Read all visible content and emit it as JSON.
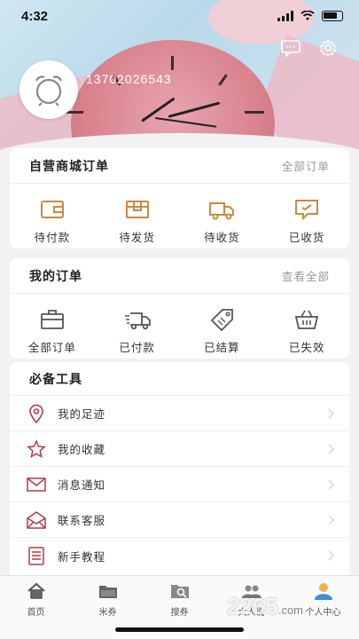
{
  "status_bar": {
    "time": "4:32"
  },
  "profile": {
    "phone": "13702026543"
  },
  "self_orders": {
    "title": "自营商城订单",
    "link": "全部订单",
    "items": [
      {
        "label": "待付款",
        "icon": "wallet-icon"
      },
      {
        "label": "待发货",
        "icon": "package-icon"
      },
      {
        "label": "待收货",
        "icon": "truck-icon"
      },
      {
        "label": "已收货",
        "icon": "message-box-icon"
      }
    ]
  },
  "my_orders": {
    "title": "我的订单",
    "link": "查看全部",
    "items": [
      {
        "label": "全部订单",
        "icon": "briefcase-icon"
      },
      {
        "label": "已付款",
        "icon": "delivery-truck-icon"
      },
      {
        "label": "已结算",
        "icon": "tag-icon"
      },
      {
        "label": "已失效",
        "icon": "basket-icon"
      }
    ]
  },
  "tools": {
    "title": "必备工具",
    "items": [
      {
        "label": "我的足迹",
        "icon": "location-pin-icon"
      },
      {
        "label": "我的收藏",
        "icon": "star-icon"
      },
      {
        "label": "消息通知",
        "icon": "envelope-icon"
      },
      {
        "label": "联系客服",
        "icon": "mail-open-icon"
      },
      {
        "label": "新手教程",
        "icon": "document-list-icon"
      }
    ]
  },
  "tabbar": {
    "items": [
      {
        "label": "首页",
        "icon": "home-icon"
      },
      {
        "label": "米券",
        "icon": "folder-icon"
      },
      {
        "label": "搜券",
        "icon": "search-folder-icon"
      },
      {
        "label": "大人说",
        "icon": "people-icon"
      },
      {
        "label": "个人中心",
        "icon": "user-icon"
      }
    ]
  },
  "watermark": {
    "text": "2265",
    "suffix": ".com"
  },
  "colors": {
    "accent": "#c98a3e",
    "icon_gray": "#555555",
    "tool_red": "#b23a48"
  }
}
